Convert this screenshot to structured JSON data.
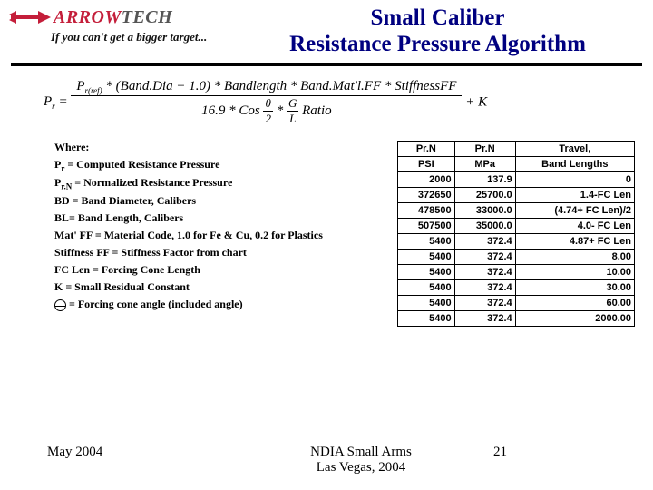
{
  "brand": {
    "a": "ARROW",
    "t": "TECH",
    "tagline": "If you can't get a bigger target..."
  },
  "title_l1": "Small Caliber",
  "title_l2": "Resistance Pressure Algorithm",
  "formula": {
    "lhs": "P",
    "lhs_sub": "r",
    "eq": " = ",
    "num": "P_{r(ref)} * (Band.Dia − 1.0) * Bandlength * Band.Mat'l.FF * StiffnessFF",
    "den_a": "16.9 * Cos ",
    "den_theta_num": "θ",
    "den_theta_den": "2",
    "den_b": " * ",
    "den_gl_num": "G",
    "den_gl_den": "L",
    "den_c": " Ratio",
    "tail": " + K"
  },
  "where": "Where:",
  "defs": {
    "d1_a": "P",
    "d1_sub": "r",
    "d1_b": " = Computed Resistance Pressure",
    "d2_a": "P",
    "d2_sub": "r.N",
    "d2_b": " = Normalized Resistance Pressure",
    "d3": "BD = Band Diameter, Calibers",
    "d4": "BL= Band Length, Calibers",
    "d5": "Mat' FF = Material Code, 1.0 for Fe & Cu, 0.2 for Plastics",
    "d6": "Stiffness FF = Stiffness Factor from chart",
    "d7": "FC Len = Forcing Cone Length",
    "d8": "K = Small Residual Constant",
    "d9": " = Forcing cone angle (included angle)"
  },
  "table": {
    "h1": "Pr.N",
    "h2": "Pr.N",
    "h3": "Travel,",
    "h1b": "PSI",
    "h2b": "MPa",
    "h3b": "Band Lengths",
    "rows": [
      [
        "2000",
        "137.9",
        "0"
      ],
      [
        "372650",
        "25700.0",
        "1.4-FC Len"
      ],
      [
        "478500",
        "33000.0",
        "(4.74+ FC Len)/2"
      ],
      [
        "507500",
        "35000.0",
        "4.0- FC Len"
      ],
      [
        "5400",
        "372.4",
        "4.87+ FC Len"
      ],
      [
        "5400",
        "372.4",
        "8.00"
      ],
      [
        "5400",
        "372.4",
        "10.00"
      ],
      [
        "5400",
        "372.4",
        "30.00"
      ],
      [
        "5400",
        "372.4",
        "60.00"
      ],
      [
        "5400",
        "372.4",
        "2000.00"
      ]
    ]
  },
  "footer": {
    "left": "May 2004",
    "center_l1": "NDIA Small Arms",
    "center_l2": "Las Vegas, 2004",
    "right": "21"
  }
}
